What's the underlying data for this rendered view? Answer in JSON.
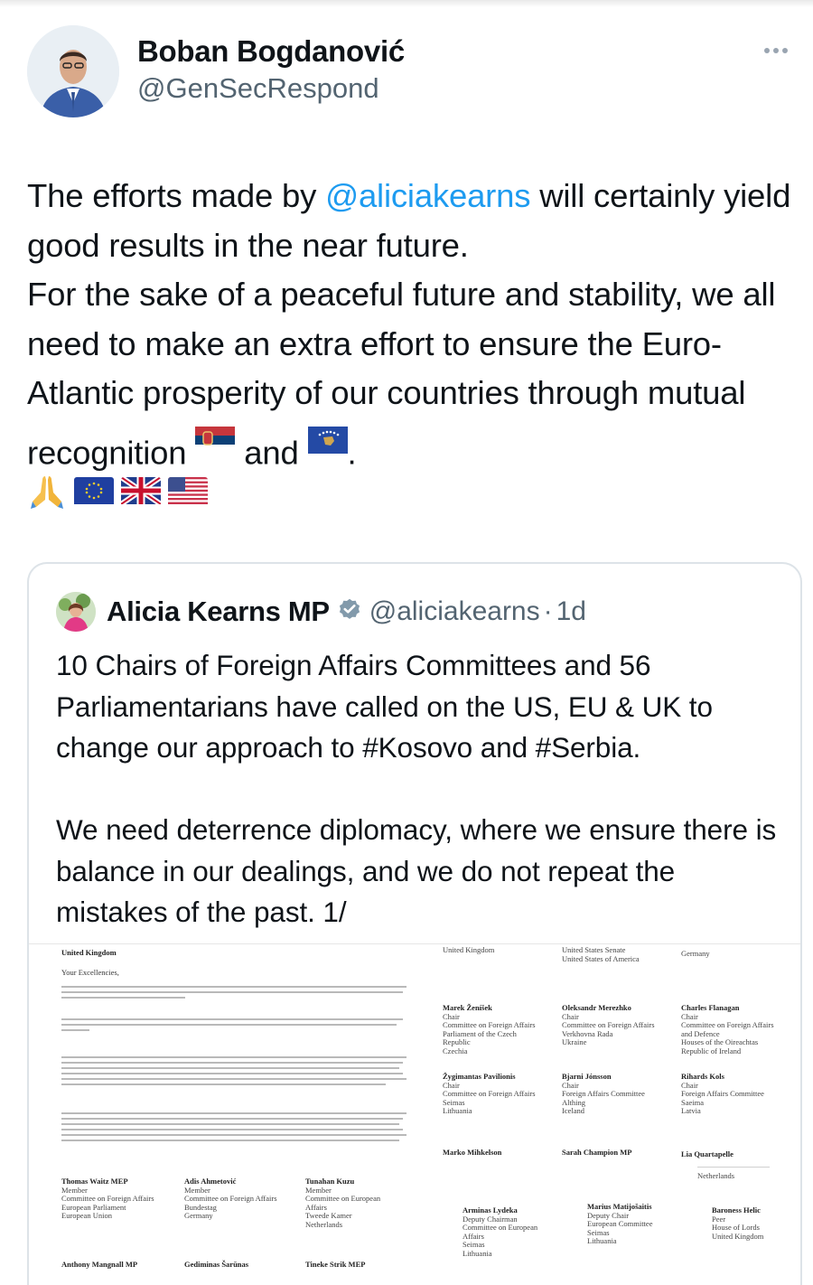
{
  "tweet": {
    "author_name": "Boban Bogdanović",
    "author_handle": "@GenSecRespond",
    "text_1": "The efforts made by ",
    "mention": "@aliciakearns",
    "text_2": " will certainly yield good results in the near future.",
    "text_3": "For the sake of a peaceful future and stability, we all need to make an extra effort to ensure the Euro-Atlantic prosperity of our countries through mutual recognition ",
    "text_4": " and ",
    "text_5": ".",
    "emojis": [
      "folded-hands",
      "flag-eu",
      "flag-uk",
      "flag-us"
    ],
    "flags_inline": [
      "flag-serbia",
      "flag-kosovo"
    ]
  },
  "quote": {
    "author_name": "Alicia Kearns MP",
    "author_handle": "@aliciakearns",
    "separator": "·",
    "time": "1d",
    "text": "10 Chairs of Foreign Affairs Committees and 56 Parliamentarians have called on the US, EU & UK to change our approach to #Kosovo and #Serbia.\n\nWe need deterrence diplomacy, where we ensure there is balance in our dealings, and we do not repeat the mistakes of the past. 1/"
  },
  "letter": {
    "left_header": "United Kingdom",
    "salutation": "Your Excellencies,",
    "left_signatories": [
      {
        "name": "Thomas Waitz MEP",
        "lines": "Member\nCommittee on Foreign Affairs\nEuropean Parliament\nEuropean Union"
      },
      {
        "name": "Adis Ahmetović",
        "lines": "Member\nCommittee on Foreign Affairs\nBundestag\nGermany"
      },
      {
        "name": "Tunahan Kuzu",
        "lines": "Member\nCommittee on European\nAffairs\nTweede Kamer\nNetherlands"
      },
      {
        "name": "Anthony Mangnall MP",
        "lines": ""
      },
      {
        "name": "Gediminas Šarūnas",
        "lines": ""
      },
      {
        "name": "Tineke Strik MEP",
        "lines": ""
      }
    ],
    "right_header": [
      "United Kingdom",
      "United States Senate\nUnited States of America",
      "Germany"
    ],
    "right_signatories": [
      {
        "name": "Marek Ženíšek",
        "lines": "Chair\nCommittee on Foreign Affairs\nParliament of the Czech\nRepublic\nCzechia"
      },
      {
        "name": "Oleksandr Merezhko",
        "lines": "Chair\nCommittee on Foreign Affairs\nVerkhovna Rada\nUkraine"
      },
      {
        "name": "Charles Flanagan",
        "lines": "Chair\nCommittee on Foreign Affairs\nand Defence\nHouses of the Oireachtas\nRepublic of Ireland"
      },
      {
        "name": "Žygimantas Pavilionis",
        "lines": "Chair\nCommittee on Foreign Affairs\nSeimas\nLithuania"
      },
      {
        "name": "Bjarni Jónsson",
        "lines": "Chair\nForeign Affairs Committee\nAlthing\nIceland"
      },
      {
        "name": "Rihards Kols",
        "lines": "Chair\nForeign Affairs Committee\nSaeima\nLatvia"
      },
      {
        "name": "Marko Mihkelson",
        "lines": ""
      },
      {
        "name": "Sarah Champion MP",
        "lines": ""
      },
      {
        "name": "Lia Quartapelle",
        "lines": ""
      },
      {
        "name": "",
        "lines": "Netherlands"
      },
      {
        "name": "Arminas Lydeka",
        "lines": "Deputy Chairman\nCommittee on European\nAffairs\nSeimas\nLithuania"
      },
      {
        "name": "Marius Matijošaitis",
        "lines": "Deputy Chair\nEuropean Committee\nSeimas\nLithuania"
      },
      {
        "name": "Baroness Helic",
        "lines": "Peer\nHouse of Lords\nUnited Kingdom"
      }
    ]
  },
  "colors": {
    "mention": "#1d9bf0",
    "muted": "#536471",
    "text": "#0f1419",
    "verified": "#829aab"
  }
}
